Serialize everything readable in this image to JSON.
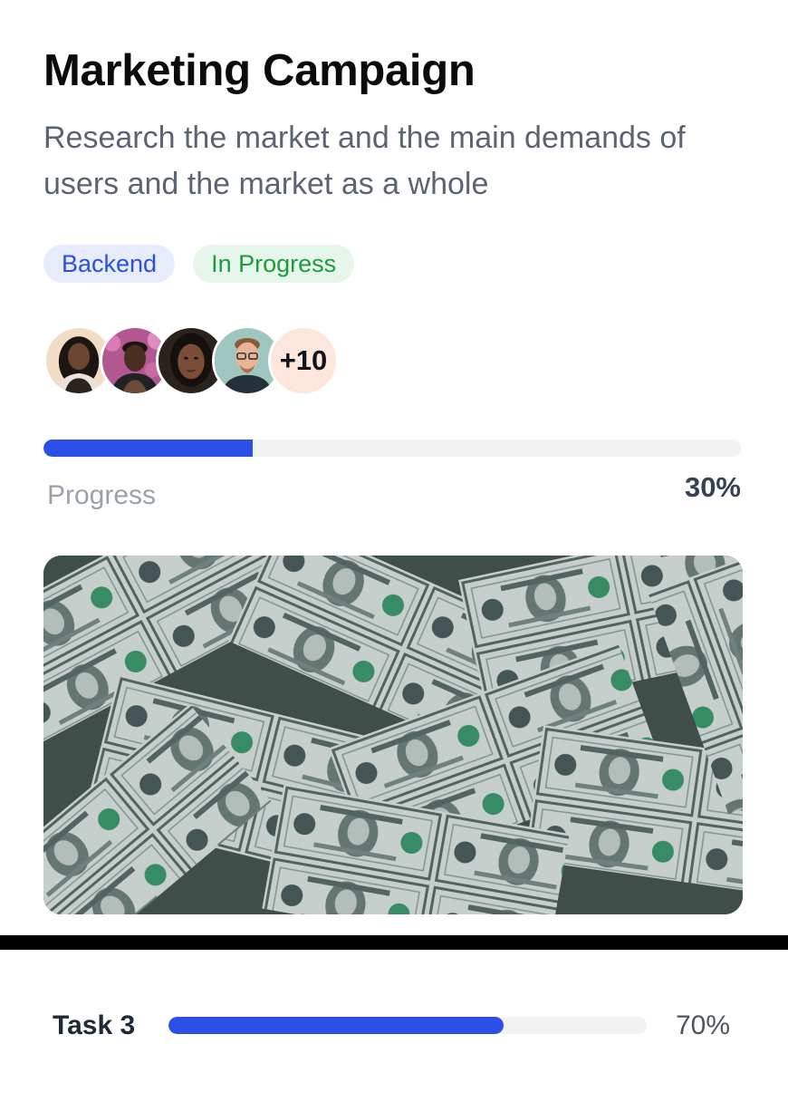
{
  "card": {
    "title": "Marketing Campaign",
    "description": "Research the market and the main demands of users and the market as a whole",
    "tags": [
      "Backend",
      "In Progress"
    ],
    "members": {
      "avatars": [
        "avatar-woman-braids",
        "avatar-man-pink-bg",
        "avatar-woman",
        "avatar-man-glasses"
      ],
      "extra_count": "+10"
    },
    "progress": {
      "label": "Progress",
      "value_text": "30%",
      "fraction": 0.3
    },
    "image": {
      "subject": "pile of one dollar bills"
    }
  },
  "task": {
    "name": "Task 3",
    "value_text": "70%",
    "fraction": 0.7
  },
  "colors": {
    "accent": "#2c4fe7",
    "backend_tag_bg": "#e7ecfd",
    "backend_tag_text": "#2e4fd8",
    "status_tag_bg": "#e6f6ea",
    "status_tag_text": "#1f9a3f"
  }
}
